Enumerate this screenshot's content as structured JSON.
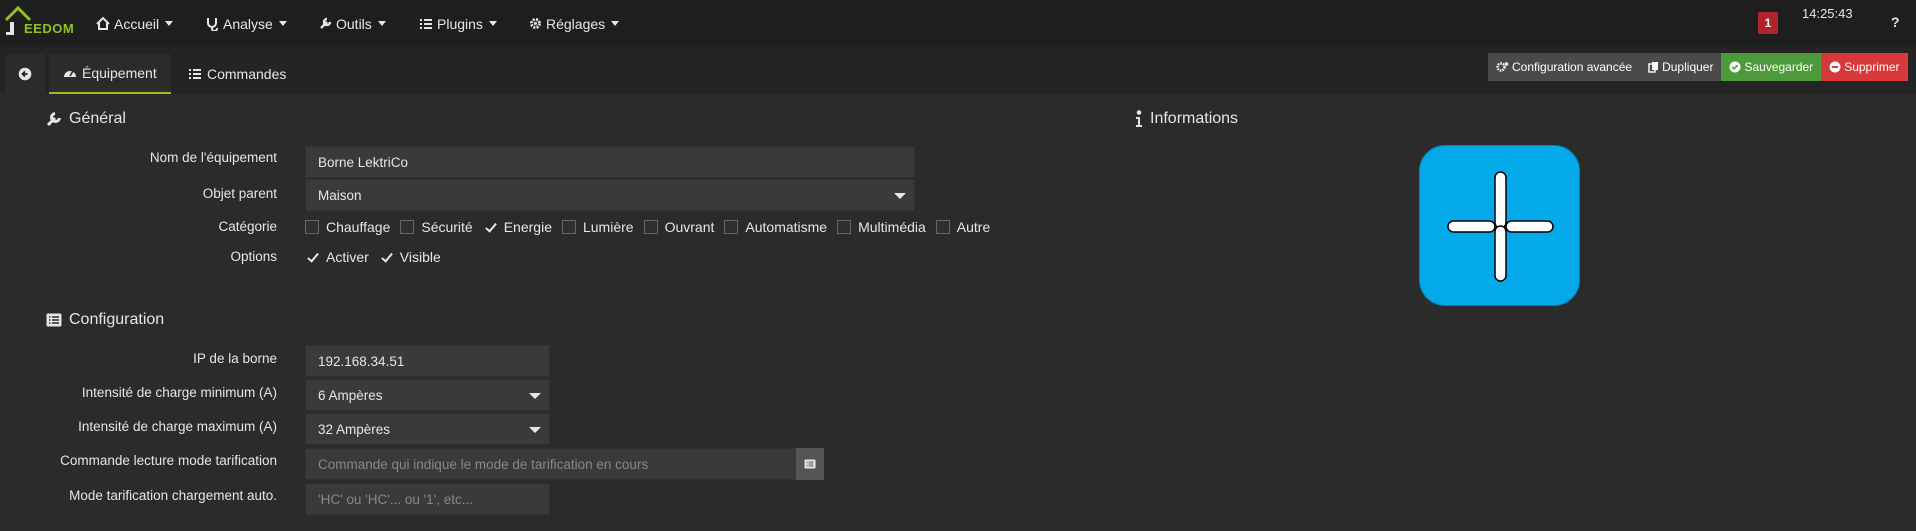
{
  "navbar": {
    "logo_text": "EEDOM",
    "menus": [
      {
        "label": "Accueil",
        "icon": "home-icon"
      },
      {
        "label": "Analyse",
        "icon": "stethoscope-icon"
      },
      {
        "label": "Outils",
        "icon": "wrench-icon"
      },
      {
        "label": "Plugins",
        "icon": "list-icon"
      },
      {
        "label": "Réglages",
        "icon": "cogs-icon"
      }
    ],
    "notification_count": "1",
    "time": "14:25:43"
  },
  "tabs": {
    "equipement": "Équipement",
    "commandes": "Commandes"
  },
  "actions": {
    "advanced": "Configuration avancée",
    "duplicate": "Dupliquer",
    "save": "Sauvegarder",
    "delete": "Supprimer"
  },
  "general": {
    "title": "Général",
    "name_label": "Nom de l'équipement",
    "name_value": "Borne LektriCo",
    "parent_label": "Objet parent",
    "parent_value": "Maison",
    "category_label": "Catégorie",
    "categories": [
      {
        "label": "Chauffage",
        "checked": false
      },
      {
        "label": "Sécurité",
        "checked": false
      },
      {
        "label": "Energie",
        "checked": true
      },
      {
        "label": "Lumière",
        "checked": false
      },
      {
        "label": "Ouvrant",
        "checked": false
      },
      {
        "label": "Automatisme",
        "checked": false
      },
      {
        "label": "Multimédia",
        "checked": false
      },
      {
        "label": "Autre",
        "checked": false
      }
    ],
    "options_label": "Options",
    "options": [
      {
        "label": "Activer",
        "checked": true
      },
      {
        "label": "Visible",
        "checked": true
      }
    ]
  },
  "information": {
    "title": "Informations"
  },
  "configuration": {
    "title": "Configuration",
    "ip_label": "IP de la borne",
    "ip_value": "192.168.34.51",
    "min_label": "Intensité de charge minimum (A)",
    "min_value": "6 Ampères",
    "max_label": "Intensité de charge maximum (A)",
    "max_value": "32 Ampères",
    "tarif_cmd_label": "Commande lecture mode tarification",
    "tarif_cmd_placeholder": "Commande qui indique le mode de tarification en cours",
    "tarif_auto_label": "Mode tarification chargement auto.",
    "tarif_auto_placeholder": "'HC' ou 'HC'... ou '1', etc..."
  },
  "colors": {
    "accent": "#95c11f",
    "save": "#4c9a3a",
    "delete": "#d9383a",
    "plugin_icon": "#03a9e8"
  }
}
